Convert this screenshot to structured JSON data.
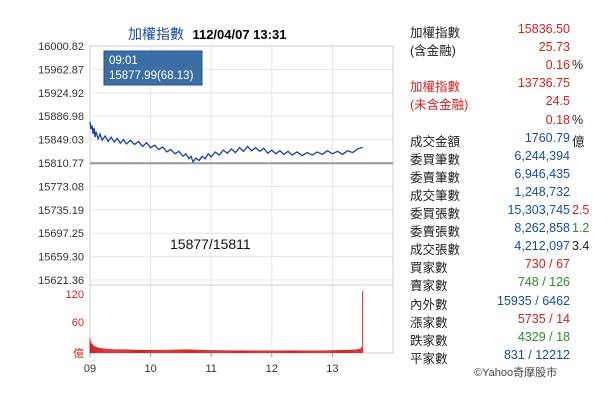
{
  "chart_title": {
    "name": "加權指數",
    "datetime": "112/04/07 13:31"
  },
  "tooltip": {
    "time": "09:01",
    "value_line": "15877.99(68.13)"
  },
  "annotation": "15877/15811",
  "colors": {
    "line": "#1a3fa0",
    "baseline": "#9a9a9a",
    "volume": "#d12121",
    "tooltip_bg": "#3a6ea5",
    "up": "#d12121",
    "down": "#2e8b2e"
  },
  "stats": [
    {
      "label": "加權指數",
      "value": "15836.50",
      "color": "red"
    },
    {
      "label": "(含金融)",
      "value": "25.73",
      "color": "red"
    },
    {
      "label": "",
      "value": "0.16",
      "color": "red",
      "suffix": "%"
    },
    {
      "label": "加權指數",
      "label_color": "red",
      "value": "13736.75",
      "color": "red"
    },
    {
      "label": "(未含金融)",
      "label_color": "red",
      "value": "24.5",
      "color": "red"
    },
    {
      "label": "",
      "value": "0.18",
      "color": "red",
      "suffix": "%"
    },
    {
      "label": "成交金額",
      "value": "1760.79",
      "color": "blue",
      "suffix": "億"
    },
    {
      "label": "委買筆數",
      "value": "6,244,394",
      "color": "blue"
    },
    {
      "label": "委賣筆數",
      "value": "6,946,435",
      "color": "blue"
    },
    {
      "label": "成交筆數",
      "value": "1,248,732",
      "color": "blue"
    },
    {
      "label": "委買張數",
      "value": "15,303,745",
      "color": "blue",
      "ext": "2.5",
      "ext_color": "red"
    },
    {
      "label": "委賣張數",
      "value": "8,262,858",
      "color": "blue",
      "ext": "1.2",
      "ext_color": "green"
    },
    {
      "label": "成交張數",
      "value": "4,212,097",
      "color": "blue",
      "ext": "3.4",
      "ext_color": "dark"
    },
    {
      "label": "買家數",
      "value_a": "730",
      "value_b": "67",
      "color_a": "red",
      "color_b": "red"
    },
    {
      "label": "賣家數",
      "value_a": "748",
      "value_b": "126",
      "color_a": "green",
      "color_b": "green"
    },
    {
      "label": "內外數",
      "value_a": "15935",
      "value_b": "6462",
      "color_a": "blue",
      "color_b": "blue"
    },
    {
      "label": "漲家數",
      "value_a": "5735",
      "value_b": "14",
      "color_a": "red",
      "color_b": "red"
    },
    {
      "label": "跌家數",
      "value_a": "4329",
      "value_b": "18",
      "color_a": "green",
      "color_b": "green"
    },
    {
      "label": "平家數",
      "value_a": "831",
      "value_b": "12212",
      "color_a": "blue",
      "color_b": "blue"
    }
  ],
  "credit": "©Yahoo奇摩股市",
  "chart_data": {
    "type": "line",
    "x_ticks": [
      "09",
      "10",
      "11",
      "12",
      "13"
    ],
    "y_ticks": [
      "16000.82",
      "15962.87",
      "15924.92",
      "15886.98",
      "15849.03",
      "15810.77",
      "15773.08",
      "15735.19",
      "15697.25",
      "15659.30",
      "15621.36"
    ],
    "ylim": [
      15621.36,
      16000.82
    ],
    "reference_value": 15810.77,
    "session_minutes": 270,
    "price_series": [
      {
        "t": 0,
        "v": 15877.99
      },
      {
        "t": 1,
        "v": 15866
      },
      {
        "t": 2,
        "v": 15872
      },
      {
        "t": 3,
        "v": 15858
      },
      {
        "t": 4,
        "v": 15868
      },
      {
        "t": 5,
        "v": 15853
      },
      {
        "t": 6,
        "v": 15862
      },
      {
        "t": 8,
        "v": 15850
      },
      {
        "t": 10,
        "v": 15858
      },
      {
        "t": 12,
        "v": 15848
      },
      {
        "t": 15,
        "v": 15855
      },
      {
        "t": 18,
        "v": 15846
      },
      {
        "t": 21,
        "v": 15853
      },
      {
        "t": 24,
        "v": 15845
      },
      {
        "t": 27,
        "v": 15851
      },
      {
        "t": 30,
        "v": 15843
      },
      {
        "t": 33,
        "v": 15849
      },
      {
        "t": 36,
        "v": 15842
      },
      {
        "t": 40,
        "v": 15848
      },
      {
        "t": 44,
        "v": 15841
      },
      {
        "t": 48,
        "v": 15846
      },
      {
        "t": 52,
        "v": 15838
      },
      {
        "t": 56,
        "v": 15844
      },
      {
        "t": 60,
        "v": 15836
      },
      {
        "t": 64,
        "v": 15840
      },
      {
        "t": 68,
        "v": 15833
      },
      {
        "t": 72,
        "v": 15837
      },
      {
        "t": 76,
        "v": 15829
      },
      {
        "t": 80,
        "v": 15833
      },
      {
        "t": 84,
        "v": 15826
      },
      {
        "t": 88,
        "v": 15830
      },
      {
        "t": 92,
        "v": 15822
      },
      {
        "t": 95,
        "v": 15826
      },
      {
        "t": 98,
        "v": 15818
      },
      {
        "t": 100,
        "v": 15822
      },
      {
        "t": 102,
        "v": 15813
      },
      {
        "t": 105,
        "v": 15819
      },
      {
        "t": 108,
        "v": 15815
      },
      {
        "t": 111,
        "v": 15822
      },
      {
        "t": 114,
        "v": 15818
      },
      {
        "t": 117,
        "v": 15826
      },
      {
        "t": 120,
        "v": 15821
      },
      {
        "t": 124,
        "v": 15829
      },
      {
        "t": 128,
        "v": 15824
      },
      {
        "t": 132,
        "v": 15832
      },
      {
        "t": 136,
        "v": 15827
      },
      {
        "t": 140,
        "v": 15834
      },
      {
        "t": 144,
        "v": 15828
      },
      {
        "t": 148,
        "v": 15836
      },
      {
        "t": 152,
        "v": 15830
      },
      {
        "t": 156,
        "v": 15838
      },
      {
        "t": 160,
        "v": 15831
      },
      {
        "t": 164,
        "v": 15836
      },
      {
        "t": 168,
        "v": 15830
      },
      {
        "t": 172,
        "v": 15835
      },
      {
        "t": 176,
        "v": 15827
      },
      {
        "t": 180,
        "v": 15832
      },
      {
        "t": 184,
        "v": 15826
      },
      {
        "t": 188,
        "v": 15831
      },
      {
        "t": 192,
        "v": 15825
      },
      {
        "t": 196,
        "v": 15830
      },
      {
        "t": 200,
        "v": 15824
      },
      {
        "t": 205,
        "v": 15829
      },
      {
        "t": 210,
        "v": 15823
      },
      {
        "t": 215,
        "v": 15828
      },
      {
        "t": 220,
        "v": 15824
      },
      {
        "t": 225,
        "v": 15829
      },
      {
        "t": 230,
        "v": 15825
      },
      {
        "t": 235,
        "v": 15831
      },
      {
        "t": 240,
        "v": 15826
      },
      {
        "t": 245,
        "v": 15830
      },
      {
        "t": 250,
        "v": 15825
      },
      {
        "t": 255,
        "v": 15831
      },
      {
        "t": 260,
        "v": 15828
      },
      {
        "t": 265,
        "v": 15834
      },
      {
        "t": 270,
        "v": 15836.5
      }
    ],
    "volume_ticks": [
      "120",
      "60",
      "億"
    ],
    "volume_max": 120,
    "volume_label_unit": "億",
    "volume_series": [
      {
        "t": 0,
        "v": 28
      },
      {
        "t": 1,
        "v": 22
      },
      {
        "t": 2,
        "v": 18
      },
      {
        "t": 4,
        "v": 14
      },
      {
        "t": 6,
        "v": 12
      },
      {
        "t": 9,
        "v": 10
      },
      {
        "t": 13,
        "v": 9
      },
      {
        "t": 18,
        "v": 8
      },
      {
        "t": 25,
        "v": 7
      },
      {
        "t": 35,
        "v": 7
      },
      {
        "t": 50,
        "v": 6
      },
      {
        "t": 70,
        "v": 6
      },
      {
        "t": 95,
        "v": 7
      },
      {
        "t": 110,
        "v": 6
      },
      {
        "t": 140,
        "v": 5
      },
      {
        "t": 170,
        "v": 5
      },
      {
        "t": 200,
        "v": 5
      },
      {
        "t": 230,
        "v": 5
      },
      {
        "t": 255,
        "v": 6
      },
      {
        "t": 264,
        "v": 7
      },
      {
        "t": 268,
        "v": 9
      },
      {
        "t": 269,
        "v": 12
      },
      {
        "t": 270,
        "v": 120
      }
    ]
  }
}
